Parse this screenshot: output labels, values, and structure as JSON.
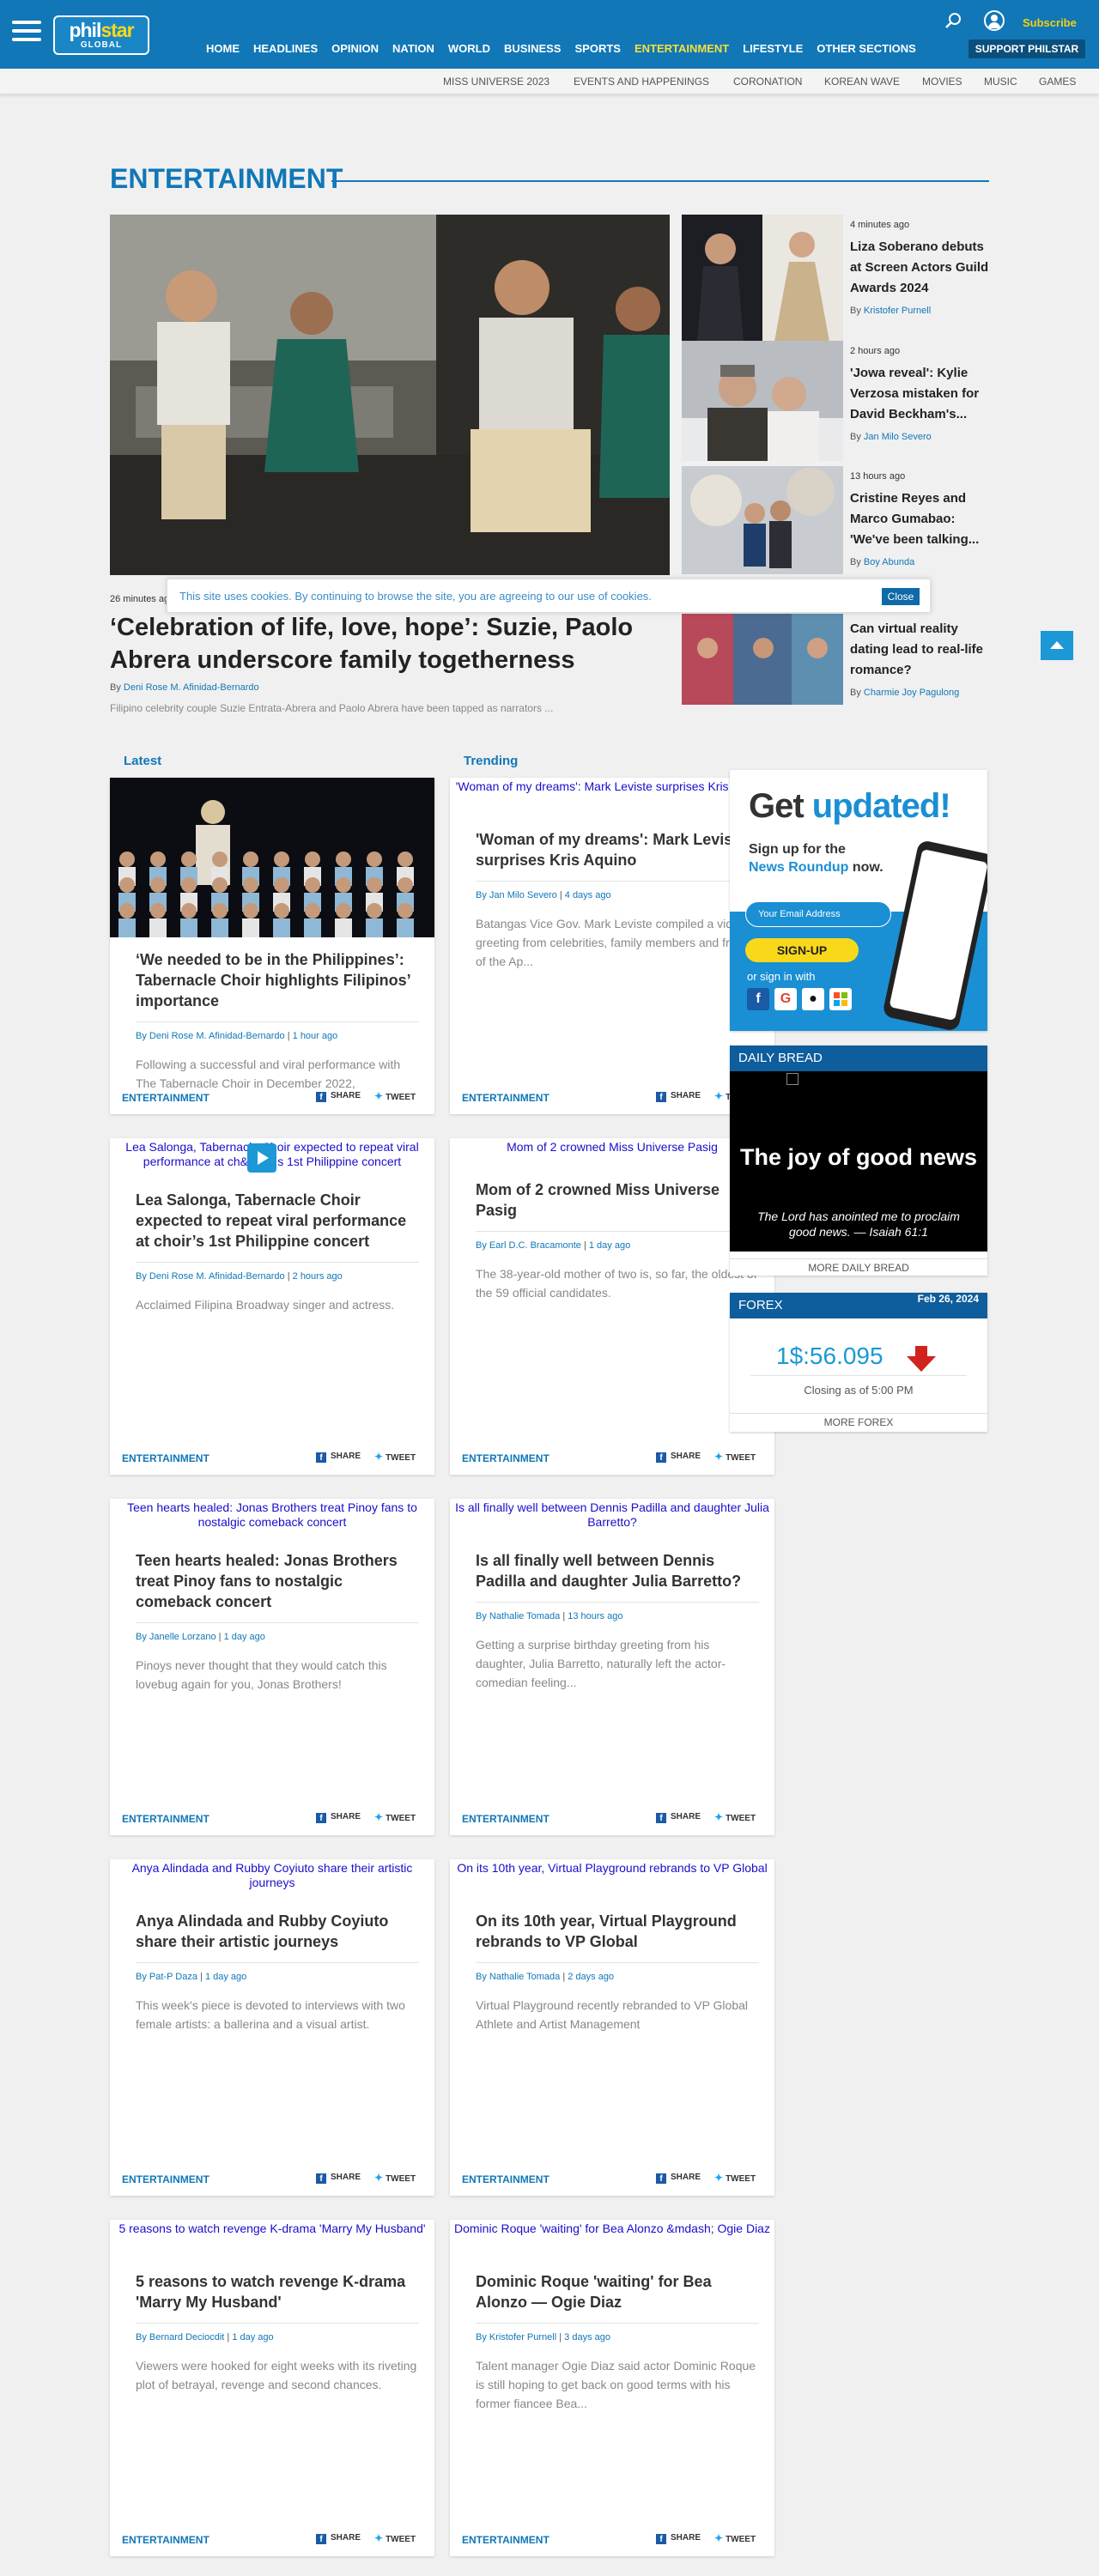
{
  "header": {
    "logo_text_a": "phil",
    "logo_text_b": "star",
    "logo_sub": "GLOBAL",
    "subscribe": "Subscribe",
    "support": "SUPPORT PHILSTAR",
    "nav": [
      "HOME",
      "HEADLINES",
      "OPINION",
      "NATION",
      "WORLD",
      "BUSINESS",
      "SPORTS",
      "ENTERTAINMENT",
      "LIFESTYLE",
      "OTHER SECTIONS"
    ],
    "active_nav": "ENTERTAINMENT",
    "accent_color": "#1177b7",
    "active_color": "#f8df3a"
  },
  "subnav": [
    "MISS UNIVERSE 2023",
    "EVENTS AND HAPPENINGS",
    "CORONATION",
    "KOREAN WAVE",
    "MOVIES",
    "MUSIC",
    "GAMES"
  ],
  "section_title": "ENTERTAINMENT",
  "hero": {
    "time": "26 minutes ago",
    "title": "‘Celebration of life, love, hope’: Suzie, Paolo Abrera underscore family togetherness",
    "by": "By",
    "author": "Deni Rose M. Afinidad-Bernardo",
    "desc": "Filipino celebrity couple Suzie Entrata-Abrera and Paolo Abrera have been tapped as narrators ..."
  },
  "side_stories": [
    {
      "time": "4 minutes ago",
      "title": "Liza Soberano debuts at Screen Actors Guild Awards 2024",
      "author": "Kristofer Purnell"
    },
    {
      "time": "2 hours ago",
      "title": "'Jowa reveal': Kylie Verzosa mistaken for David Beckham's...",
      "author": "Jan Milo Severo"
    },
    {
      "time": "13 hours ago",
      "title": "Cristine Reyes and Marco Gumabao: 'We've been talking...",
      "author": "Boy Abunda"
    },
    {
      "time": "",
      "title": "Can virtual reality dating lead to real-life romance?",
      "author": "Charmie Joy Pagulong"
    }
  ],
  "cookie": {
    "text": "This site uses cookies. By continuing to browse the site, you are agreeing to our use of cookies.",
    "close": "Close"
  },
  "tabs": {
    "latest": "Latest",
    "trending": "Trending"
  },
  "card_labels": {
    "category": "ENTERTAINMENT",
    "share": "SHARE",
    "tweet": "TWEET",
    "by": "By"
  },
  "cards": [
    {
      "alt": "",
      "title": "‘We needed to be in the Philippines’: Tabernacle Choir highlights Filipinos’ importance",
      "author": "Deni Rose M. Afinidad-Bernardo",
      "time": "1 hour ago",
      "desc": "Following a successful and viral performance with The Tabernacle Choir in December 2022,"
    },
    {
      "alt": "'Woman of my dreams': Mark Leviste surprises Kris Aquino",
      "title": "'Woman of my dreams': Mark Leviste surprises Kris Aquino",
      "author": "Jan Milo Severo",
      "time": "4 days ago",
      "desc": "Batangas Vice Gov. Mark Leviste compiled a video greeting from celebrities, family members and friends of the Ap..."
    },
    {
      "alt": "Lea Salonga, Tabernacle Choir expected to repeat viral performance at ch&apos;s 1st Philippine concert",
      "title": "Lea Salonga, Tabernacle Choir expected to repeat viral performance at choir’s 1st Philippine concert",
      "author": "Deni Rose M. Afinidad-Bernardo",
      "time": "2 hours ago",
      "desc": "Acclaimed Filipina Broadway singer and actress."
    },
    {
      "alt": "Mom of 2 crowned Miss Universe Pasig",
      "title": "Mom of 2 crowned Miss Universe Pasig",
      "author": "Earl D.C. Bracamonte",
      "time": "1 day ago",
      "desc": "The 38-year-old mother of two is, so far, the oldest of the 59 official candidates."
    },
    {
      "alt": "Teen hearts healed: Jonas Brothers treat Pinoy fans to nostalgic comeback concert",
      "title": "Teen hearts healed: Jonas Brothers treat Pinoy fans to nostalgic comeback concert",
      "author": "Janelle Lorzano",
      "time": "1 day ago",
      "desc": "Pinoys never thought that they would catch this lovebug again for you, Jonas Brothers!"
    },
    {
      "alt": "Is all finally well between Dennis Padilla and daughter Julia Barretto?",
      "title": "Is all finally well between Dennis Padilla and daughter Julia Barretto?",
      "author": "Nathalie Tomada",
      "time": "13 hours ago",
      "desc": "Getting a surprise birthday greeting from his daughter, Julia Barretto, naturally left the actor-comedian feeling..."
    },
    {
      "alt": "Anya Alindada and Rubby Coyiuto share their artistic journeys",
      "title": "Anya Alindada and Rubby Coyiuto share their artistic journeys",
      "author": "Pat-P Daza",
      "time": "1 day ago",
      "desc": "This week's piece is devoted to interviews with two female artists: a ballerina and a visual artist."
    },
    {
      "alt": "On its 10th year, Virtual Playground rebrands to VP Global",
      "title": "On its 10th year, Virtual Playground rebrands to VP Global",
      "author": "Nathalie Tomada",
      "time": "2 days ago",
      "desc": "Virtual Playground recently rebranded to VP Global Athlete and Artist Management"
    },
    {
      "alt": "5 reasons to watch revenge K-drama 'Marry My Husband'",
      "title": "5 reasons to watch revenge K-drama 'Marry My Husband'",
      "author": "Bernard Deciocdit",
      "time": "1 day ago",
      "desc": "Viewers were hooked for eight weeks with its riveting plot of betrayal, revenge and second chances."
    },
    {
      "alt": "Dominic Roque 'waiting' for Bea Alonzo &mdash; Ogie Diaz",
      "title": "Dominic Roque 'waiting' for Bea Alonzo — Ogie Diaz",
      "author": "Kristofer Purnell",
      "time": "3 days ago",
      "desc": "Talent manager Ogie Diaz said actor Dominic Roque is still hoping to get back on good terms with his former fiancee Bea..."
    }
  ],
  "promo": {
    "title_a": "Get ",
    "title_b": "updated!",
    "line1": "Sign up for the",
    "line2": "News Roundup",
    "line2_b": " now.",
    "input_placeholder": "Your Email Address",
    "button": "SIGN-UP",
    "or": "or sign in with"
  },
  "daily_bread": {
    "label": "DAILY BREAD",
    "title": "The joy of good news",
    "verse": "The Lord has anointed me to proclaim good news. — Isaiah 61:1",
    "more": "MORE DAILY BREAD"
  },
  "forex": {
    "label": "FOREX",
    "date": "Feb 26, 2024",
    "value": "1$:56.095",
    "as_of": "Closing as of 5:00 PM",
    "more": "MORE FOREX",
    "trend_color": "#d0231d"
  }
}
